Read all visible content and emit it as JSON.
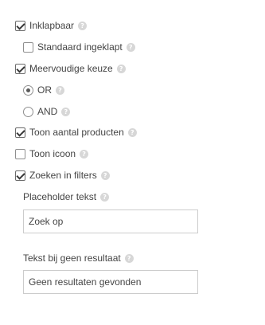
{
  "options": {
    "collapsible": {
      "label": "Inklapbaar",
      "checked": true
    },
    "default_collapsed": {
      "label": "Standaard ingeklapt",
      "checked": false
    },
    "multiple_choice": {
      "label": "Meervoudige keuze",
      "checked": true
    },
    "or": {
      "label": "OR",
      "selected": true
    },
    "and": {
      "label": "AND",
      "selected": false
    },
    "show_product_count": {
      "label": "Toon aantal producten",
      "checked": true
    },
    "show_icon": {
      "label": "Toon icoon",
      "checked": false
    },
    "search_in_filters": {
      "label": "Zoeken in filters",
      "checked": true
    }
  },
  "placeholder_text": {
    "label": "Placeholder tekst",
    "value": "Zoek op"
  },
  "no_result_text": {
    "label": "Tekst bij geen resultaat",
    "value": "Geen resultaten gevonden"
  },
  "help_glyph": "?"
}
